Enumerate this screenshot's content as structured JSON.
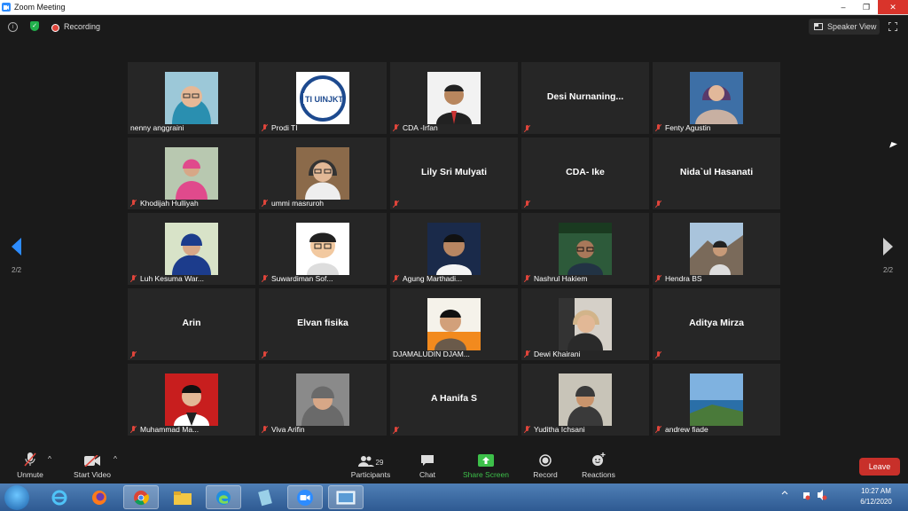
{
  "window": {
    "title": "Zoom Meeting"
  },
  "topbar": {
    "recording_label": "Recording",
    "speaker_view_label": "Speaker View"
  },
  "navigation": {
    "left_page": "2/2",
    "right_page": "2/2"
  },
  "participants": [
    {
      "name": "nenny anggraini",
      "display": "",
      "muted": false,
      "photo": "woman-teal-hijab"
    },
    {
      "name": "Prodi TI",
      "display": "",
      "muted": true,
      "photo": "ti-uinjkt-logo"
    },
    {
      "name": "CDA -Irfan",
      "display": "",
      "muted": true,
      "photo": "man-suit"
    },
    {
      "name": "",
      "display": "Desi  Nurnaning...",
      "muted": true,
      "photo": ""
    },
    {
      "name": "Fenty Agustin",
      "display": "",
      "muted": true,
      "photo": "woman-purple"
    },
    {
      "name": "Khodijah Hulliyah",
      "display": "",
      "muted": true,
      "photo": "woman-pink-hijab"
    },
    {
      "name": "ummi masruroh",
      "display": "",
      "muted": true,
      "photo": "woman-glasses"
    },
    {
      "name": "",
      "display": "Lily Sri Mulyati",
      "muted": true,
      "photo": ""
    },
    {
      "name": "",
      "display": "CDA- Ike",
      "muted": true,
      "photo": ""
    },
    {
      "name": "",
      "display": "Nida`ul Hasanati",
      "muted": true,
      "photo": ""
    },
    {
      "name": "Luh Kesuma War...",
      "display": "",
      "muted": true,
      "photo": "woman-blue-hijab"
    },
    {
      "name": "Suwardiman Sof...",
      "display": "",
      "muted": true,
      "photo": "cartoon-man"
    },
    {
      "name": "Agung Marthadi...",
      "display": "",
      "muted": true,
      "photo": "man-dark-blue"
    },
    {
      "name": "Nashrul Hakiem",
      "display": "",
      "muted": true,
      "photo": "man-green"
    },
    {
      "name": "Hendra BS",
      "display": "",
      "muted": true,
      "photo": "man-mountain"
    },
    {
      "name": "",
      "display": "Arin",
      "muted": true,
      "photo": ""
    },
    {
      "name": "",
      "display": "Elvan fisika",
      "muted": true,
      "photo": ""
    },
    {
      "name": "DJAMALUDIN DJAM...",
      "display": "",
      "muted": false,
      "photo": "man-orange"
    },
    {
      "name": "Dewi Khairani",
      "display": "",
      "muted": true,
      "photo": "woman-car"
    },
    {
      "name": "",
      "display": "Aditya Mirza",
      "muted": true,
      "photo": ""
    },
    {
      "name": "Muhammad Ma...",
      "display": "",
      "muted": true,
      "photo": "man-red-bg"
    },
    {
      "name": "Viva Arifin",
      "display": "",
      "muted": true,
      "photo": "woman-grey-hijab"
    },
    {
      "name": "",
      "display": "A Hanifa S",
      "muted": true,
      "photo": ""
    },
    {
      "name": "Yuditha Ichsani",
      "display": "",
      "muted": true,
      "photo": "woman-hijab-room"
    },
    {
      "name": "andrew fiade",
      "display": "",
      "muted": true,
      "photo": "sea-landscape"
    }
  ],
  "toolbar": {
    "unmute": "Unmute",
    "start_video": "Start Video",
    "participants_label": "Participants",
    "participants_count": "29",
    "chat": "Chat",
    "share_screen": "Share Screen",
    "record": "Record",
    "reactions": "Reactions",
    "leave": "Leave"
  },
  "taskbar": {
    "time": "10:27 AM",
    "date": "6/12/2020"
  },
  "colors": {
    "accent": "#2d8cff",
    "leave": "#c8302a",
    "share": "#3dc04a",
    "muted": "#e0453b"
  }
}
